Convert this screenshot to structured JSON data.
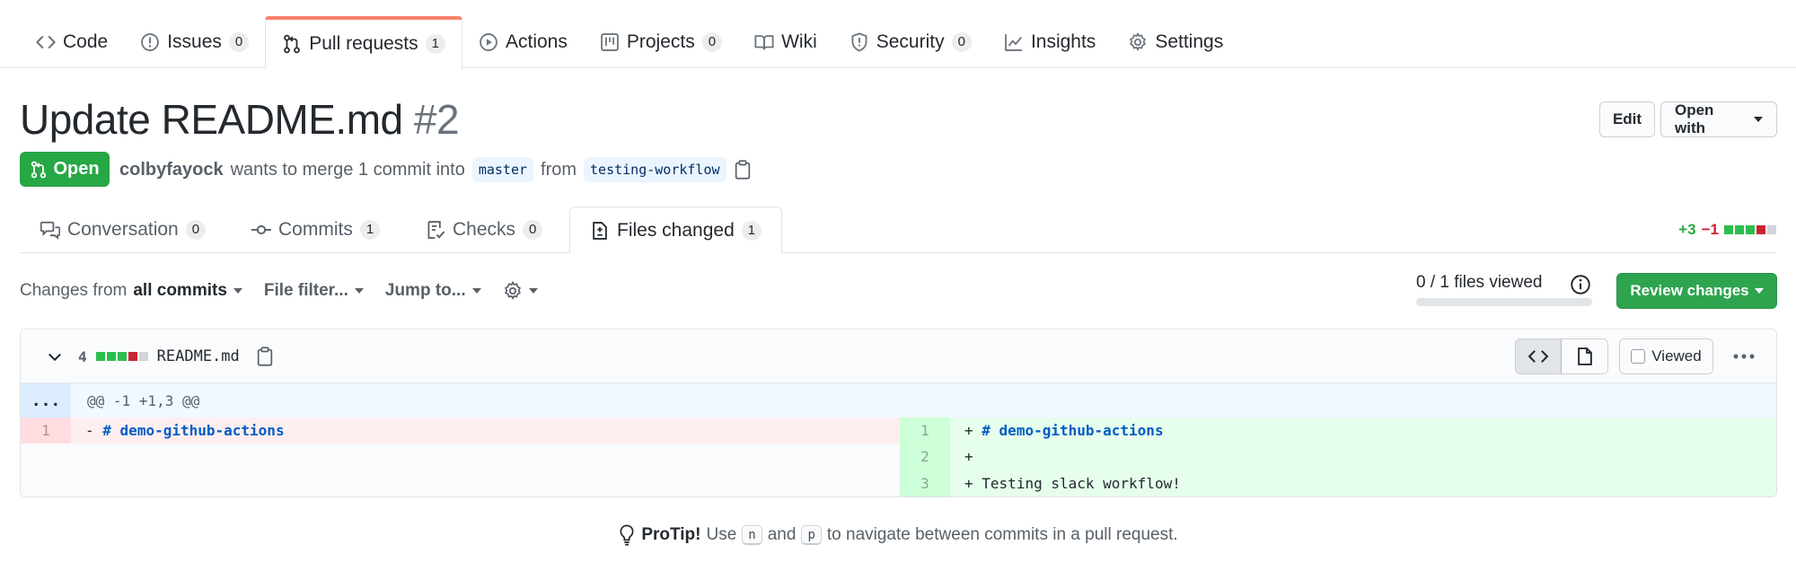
{
  "repo_nav": {
    "tabs": [
      {
        "label": "Code",
        "icon": "code-icon"
      },
      {
        "label": "Issues",
        "count": "0",
        "icon": "issue-icon"
      },
      {
        "label": "Pull requests",
        "count": "1",
        "icon": "pull-request-icon",
        "selected": true
      },
      {
        "label": "Actions",
        "icon": "play-icon"
      },
      {
        "label": "Projects",
        "count": "0",
        "icon": "project-icon"
      },
      {
        "label": "Wiki",
        "icon": "book-icon"
      },
      {
        "label": "Security",
        "count": "0",
        "icon": "shield-icon"
      },
      {
        "label": "Insights",
        "icon": "graph-icon"
      },
      {
        "label": "Settings",
        "icon": "gear-icon"
      }
    ]
  },
  "pr": {
    "title": "Update README.md",
    "number": "#2",
    "edit_label": "Edit",
    "open_with_label": "Open with",
    "state": "Open",
    "author": "colbyfayock",
    "merge_text": "wants to merge 1 commit into",
    "base_branch": "master",
    "from_text": "from",
    "head_branch": "testing-workflow"
  },
  "pr_tabs": [
    {
      "label": "Conversation",
      "count": "0",
      "icon": "comment-discussion-icon"
    },
    {
      "label": "Commits",
      "count": "1",
      "icon": "commit-icon"
    },
    {
      "label": "Checks",
      "count": "0",
      "icon": "checklist-icon"
    },
    {
      "label": "Files changed",
      "count": "1",
      "icon": "file-diff-icon",
      "selected": true
    }
  ],
  "diffstat": {
    "additions": "+3",
    "deletions": "−1"
  },
  "toolbar": {
    "changes_prefix": "Changes from",
    "changes_value": "all commits",
    "file_filter": "File filter...",
    "jump_to": "Jump to...",
    "files_viewed": "0 / 1 files viewed",
    "files_viewed_fraction": 0,
    "review_label": "Review changes"
  },
  "file": {
    "change_count": "4",
    "name": "README.md",
    "viewed_label": "Viewed",
    "hunk_expand": "...",
    "hunk_header": "@@ -1 +1,3 @@",
    "left_lines": [
      {
        "num": "1",
        "marker": "-",
        "code": "# demo-github-actions",
        "heading": true
      }
    ],
    "right_lines": [
      {
        "num": "1",
        "marker": "+",
        "code": "# demo-github-actions",
        "heading": true
      },
      {
        "num": "2",
        "marker": "+",
        "code": ""
      },
      {
        "num": "3",
        "marker": "+",
        "code": "Testing slack workflow!"
      }
    ]
  },
  "protip": {
    "label": "ProTip!",
    "use": "Use",
    "key_n": "n",
    "and": "and",
    "key_p": "p",
    "rest": "to navigate between commits in a pull request."
  },
  "colors": {
    "open_green": "#28a745",
    "review_green": "#2ea44f",
    "deletion_red": "#cb2431",
    "tab_accent": "#f9826c"
  }
}
